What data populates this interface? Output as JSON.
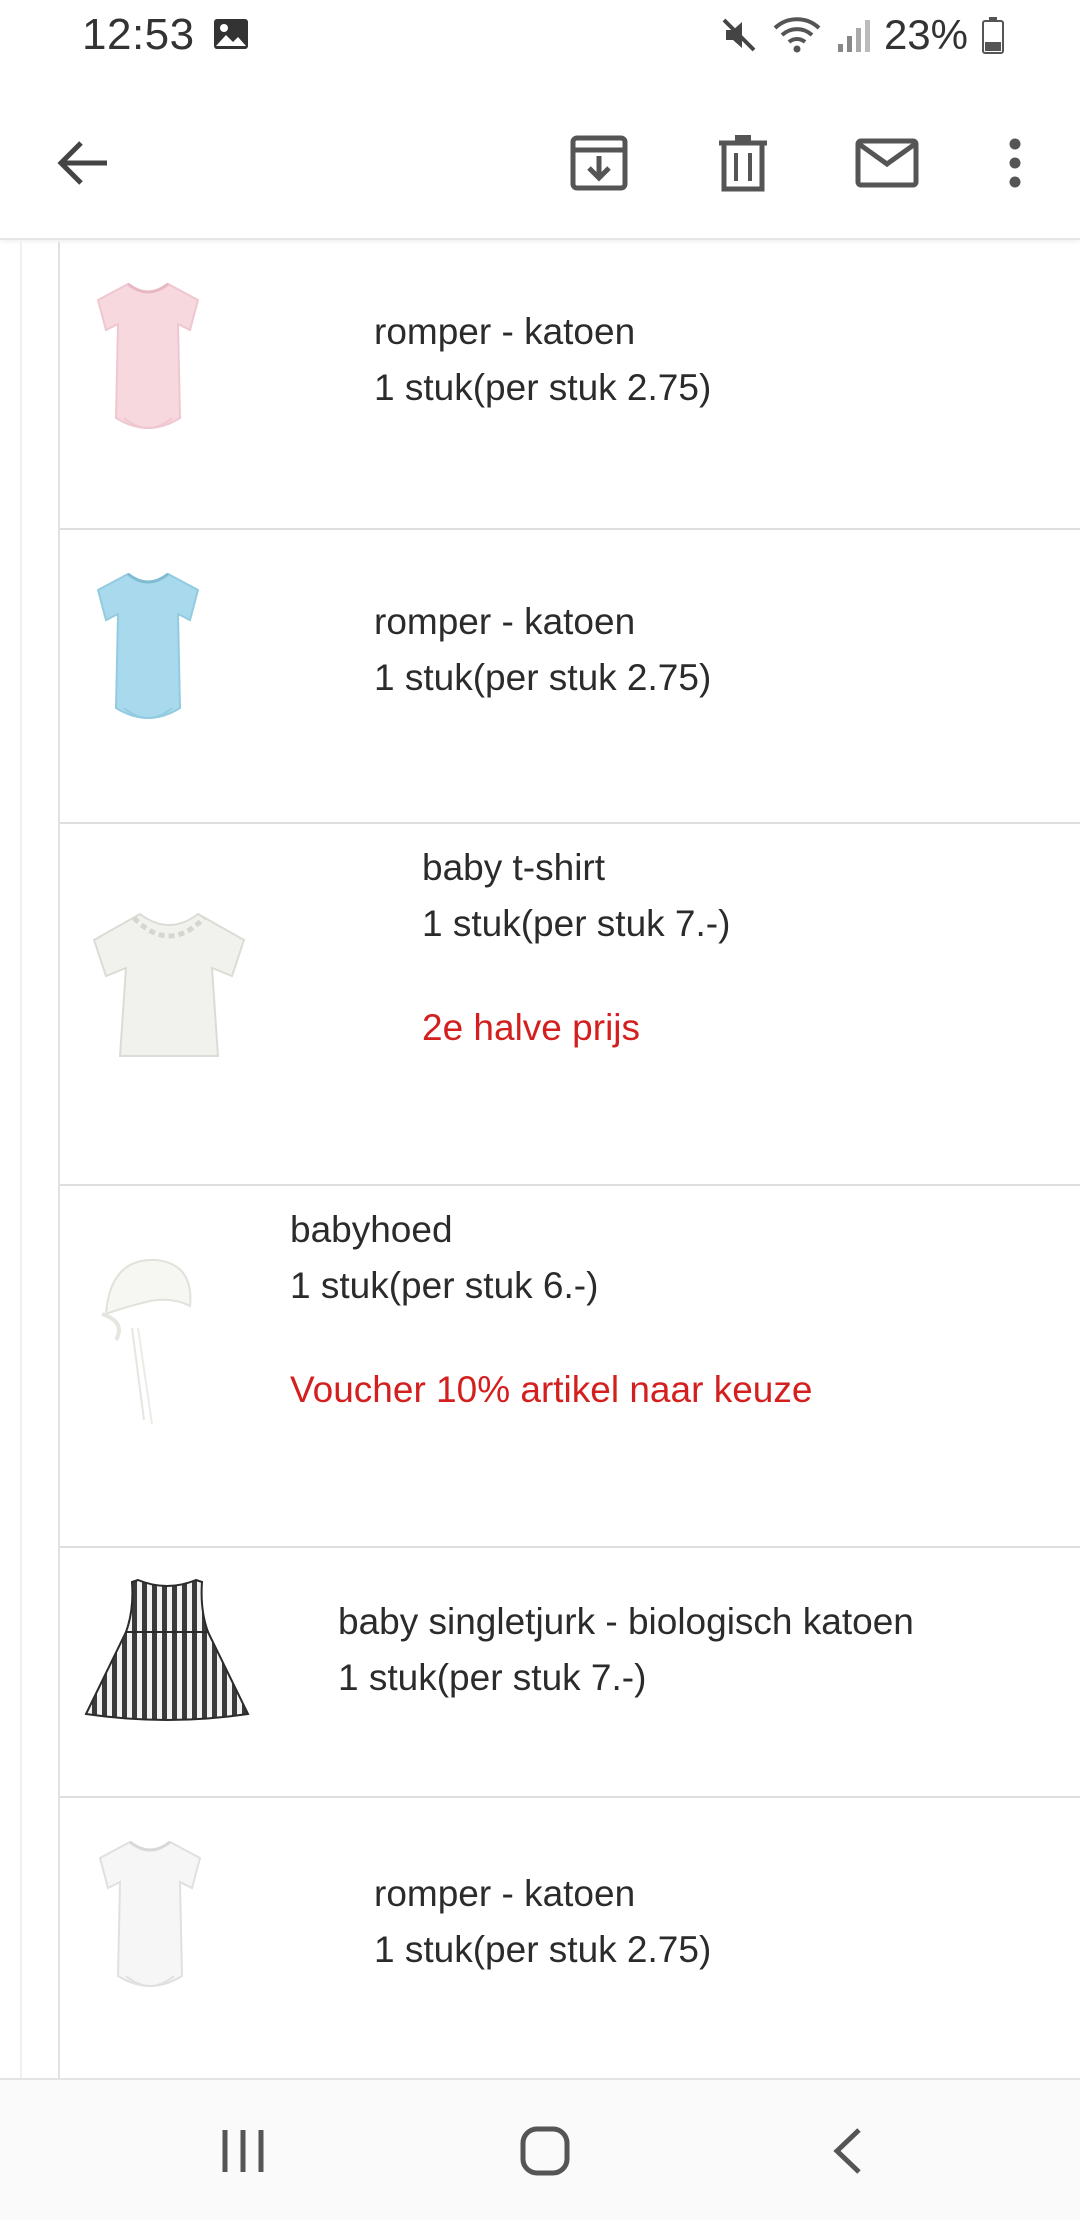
{
  "status_bar": {
    "time": "12:53",
    "battery": "23%",
    "icons": [
      "image-icon",
      "mute-icon",
      "wifi-icon",
      "signal-icon",
      "battery-icon"
    ]
  },
  "toolbar": {
    "icons": [
      "back-arrow-icon",
      "archive-icon",
      "trash-icon",
      "mail-icon",
      "more-vert-icon"
    ]
  },
  "items": [
    {
      "name": "romper - katoen",
      "qty": "1 stuk(per stuk 2.75)",
      "promo": "",
      "thumb": "pink-romper"
    },
    {
      "name": "romper - katoen",
      "qty": "1 stuk(per stuk 2.75)",
      "promo": "",
      "thumb": "blue-romper"
    },
    {
      "name": "baby t-shirt",
      "qty": "1 stuk(per stuk 7.-)",
      "promo": "2e halve prijs",
      "thumb": "white-tshirt"
    },
    {
      "name": "babyhoed",
      "qty": "1 stuk(per stuk 6.-)",
      "promo": "Voucher 10% artikel naar keuze",
      "thumb": "white-hat"
    },
    {
      "name": "baby singletjurk - biologisch katoen",
      "qty": "1 stuk(per stuk 7.-)",
      "promo": "",
      "thumb": "striped-dress"
    },
    {
      "name": "romper - katoen",
      "qty": "1 stuk(per stuk 2.75)",
      "promo": "",
      "thumb": "white-romper"
    }
  ],
  "colors": {
    "promo": "#d41f1f",
    "text": "#2b2b2b",
    "icon": "#5f5f5f",
    "romper_pink": "#f7d8df",
    "romper_blue": "#a9d9ec"
  },
  "nav_bar": {
    "icons": [
      "recents-icon",
      "home-icon",
      "nav-back-icon"
    ]
  }
}
